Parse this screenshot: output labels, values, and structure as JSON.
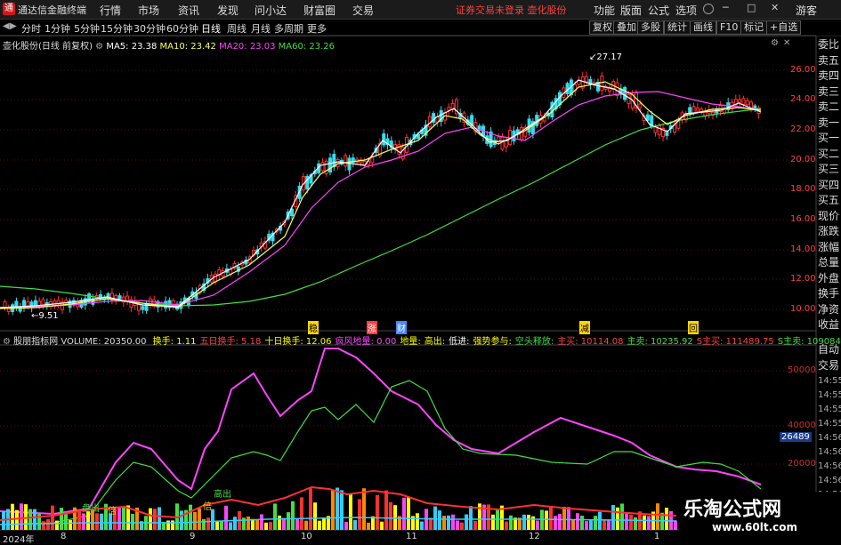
{
  "app": {
    "logo_glyph": "通",
    "title": "通达信金融终端"
  },
  "menu": [
    "行情",
    "市场",
    "资讯",
    "发现",
    "问小达",
    "财富圈",
    "交易"
  ],
  "notice": "证券交易未登录  壶化股份",
  "toolbar_right": [
    "功能",
    "版面",
    "公式",
    "选项"
  ],
  "user_label": "游客",
  "periods": [
    "分时",
    "1分钟",
    "5分钟",
    "15分钟",
    "30分钟",
    "60分钟",
    "日线",
    "周线",
    "月线",
    "多周期",
    "更多"
  ],
  "active_period": "日线",
  "right_buttons": [
    "复权",
    "叠加",
    "多股",
    "统计",
    "画线",
    "F10",
    "标记",
    "+自选"
  ],
  "stock_title": "壶化股份(日线 前复权)",
  "ma": {
    "ma5": "MA5: 23.38",
    "ma10": "MA10: 23.42",
    "ma20": "MA20: 23.03",
    "ma60": "MA60: 23.26",
    "colors": {
      "ma5": "#ffffff",
      "ma10": "#ffff66",
      "ma20": "#ff44ff",
      "ma60": "#44dd44"
    }
  },
  "price_axis": [
    "26.00",
    "24.00",
    "22.00",
    "20.00",
    "18.00",
    "16.00",
    "14.00",
    "12.00",
    "10.00"
  ],
  "high_label": "27.17",
  "low_label": "9.51",
  "markers": [
    {
      "text": "稳",
      "color": "#ffd700"
    },
    {
      "text": "涨",
      "color": "#ff4040"
    },
    {
      "text": "财",
      "color": "#4488ff"
    },
    {
      "text": "减",
      "color": "#ffd700"
    },
    {
      "text": "回",
      "color": "#ffd700"
    }
  ],
  "indicator": {
    "name": "股朋指标网",
    "volume": "VOLUME: 20350.00",
    "items": [
      {
        "text": "换手: 1.11",
        "color": "#ffff00"
      },
      {
        "text": "五日换手: 5.18",
        "color": "#ff4040"
      },
      {
        "text": "十日换手: 12.06",
        "color": "#ffff00"
      },
      {
        "text": "疯风地量: 0.00",
        "color": "#ff44ff"
      },
      {
        "text": "地量:",
        "color": "#ffff00"
      },
      {
        "text": "高出:",
        "color": "#ffff00"
      },
      {
        "text": "低进:",
        "color": "#ffffff"
      },
      {
        "text": "强势参与:",
        "color": "#ffff00"
      },
      {
        "text": "空头释放:",
        "color": "#44dd44"
      },
      {
        "text": "主买: 10114.08",
        "color": "#ff4040"
      },
      {
        "text": "主卖: 10235.92",
        "color": "#44dd44"
      },
      {
        "text": "S主买: 111489.75",
        "color": "#ff4040"
      },
      {
        "text": "S主卖: 109084",
        "color": "#44dd44"
      }
    ]
  },
  "vol_axis": [
    "50000",
    "40000",
    "30000",
    "20000"
  ],
  "vol_marker": "26489",
  "sub_labels": [
    {
      "text": "盘出",
      "color": "#44dd44"
    },
    {
      "text": "倍",
      "color": "#ffd700"
    },
    {
      "text": "高出",
      "color": "#44dd44"
    },
    {
      "text": "倍",
      "color": "#ffd700"
    }
  ],
  "x_axis": [
    "2024年",
    "8",
    "9",
    "10",
    "11",
    "12",
    "1"
  ],
  "side_panel": [
    "委比",
    "卖五",
    "卖四",
    "卖三",
    "卖二",
    "卖一",
    "买一",
    "买二",
    "买三",
    "买四",
    "买五",
    "现价",
    "涨跌",
    "涨幅",
    "总量",
    "外盘",
    "换手",
    "净资",
    "收益"
  ],
  "side_panel2": [
    "自动",
    "交易"
  ],
  "side_times": [
    "14:55",
    "14:55",
    "14:55",
    "14:55",
    "14:56",
    "14:56",
    "14:56",
    "14:56",
    "14:56",
    "14:56",
    "14:56"
  ],
  "watermark": {
    "line1": "乐淘公式网",
    "line2": "www.60lt.com"
  }
}
